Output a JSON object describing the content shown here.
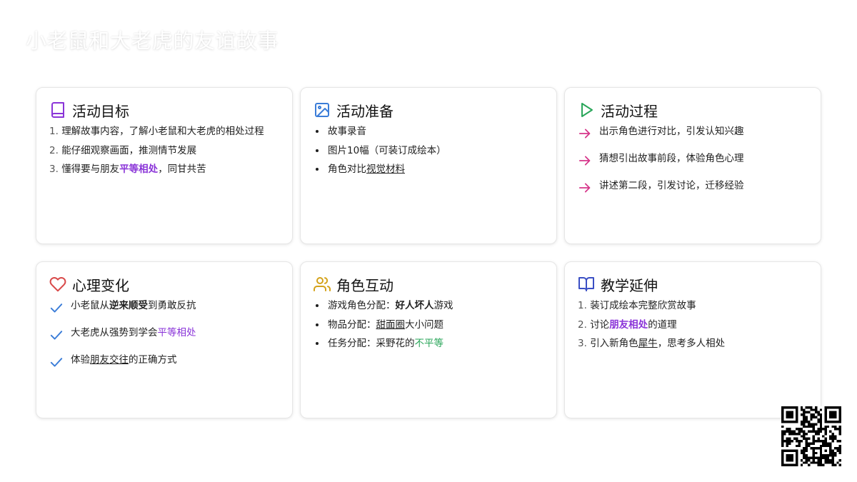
{
  "page": {
    "title": "小老鼠和大老虎的友谊故事"
  },
  "cards": {
    "goals": {
      "title": "活动目标",
      "icon": "book-icon",
      "items": [
        {
          "text": "理解故事内容，了解小老鼠和大老虎的相处过程"
        },
        {
          "text": "能仔细观察画面，推测情节发展"
        },
        {
          "pre": "懂得要与朋友",
          "em": "平等相处",
          "post": "，同甘共苦"
        }
      ]
    },
    "prep": {
      "title": "活动准备",
      "icon": "image-icon",
      "items": [
        {
          "text": "故事录音"
        },
        {
          "text": "图片10幅（可装订成绘本）"
        },
        {
          "pre": "角色对比",
          "em": "视觉材料"
        }
      ]
    },
    "process": {
      "title": "活动过程",
      "icon": "play-icon",
      "items": [
        {
          "text": "出示角色进行对比，引发认知兴趣"
        },
        {
          "text": "猜想引出故事前段，体验角色心理"
        },
        {
          "text": "讲述第二段，引发讨论，迁移经验"
        }
      ]
    },
    "mind": {
      "title": "心理变化",
      "icon": "heart-icon",
      "items": [
        {
          "pre": "小老鼠从",
          "em": "逆来顺受",
          "post": "到勇敢反抗"
        },
        {
          "pre": "大老虎从强势到学会",
          "em": "平等相处"
        },
        {
          "pre": "体验",
          "em": "朋友交往",
          "post": "的正确方式"
        }
      ]
    },
    "roles": {
      "title": "角色互动",
      "icon": "users-icon",
      "items": [
        {
          "pre": "游戏角色分配：",
          "em": "好人坏人",
          "post": "游戏"
        },
        {
          "pre": "物品分配：",
          "em": "甜面圈",
          "post": "大小问题"
        },
        {
          "pre": "任务分配：采野花的",
          "em": "不平等"
        }
      ]
    },
    "extend": {
      "title": "教学延伸",
      "icon": "open-book-icon",
      "items": [
        {
          "text": "装订成绘本完整欣赏故事"
        },
        {
          "pre": "讨论",
          "em": "朋友相处",
          "post": "的道理"
        },
        {
          "pre": "引入新角色",
          "em": "犀牛",
          "post": "，思考多人相处"
        }
      ]
    }
  },
  "colors": {
    "purple": "#8a34d8",
    "blue": "#3b7dd8",
    "green": "#2aa65a",
    "pink": "#d6368a",
    "red": "#d94a4a",
    "gold": "#d4a21a"
  },
  "qr": {
    "icon": "qr-code-icon"
  }
}
